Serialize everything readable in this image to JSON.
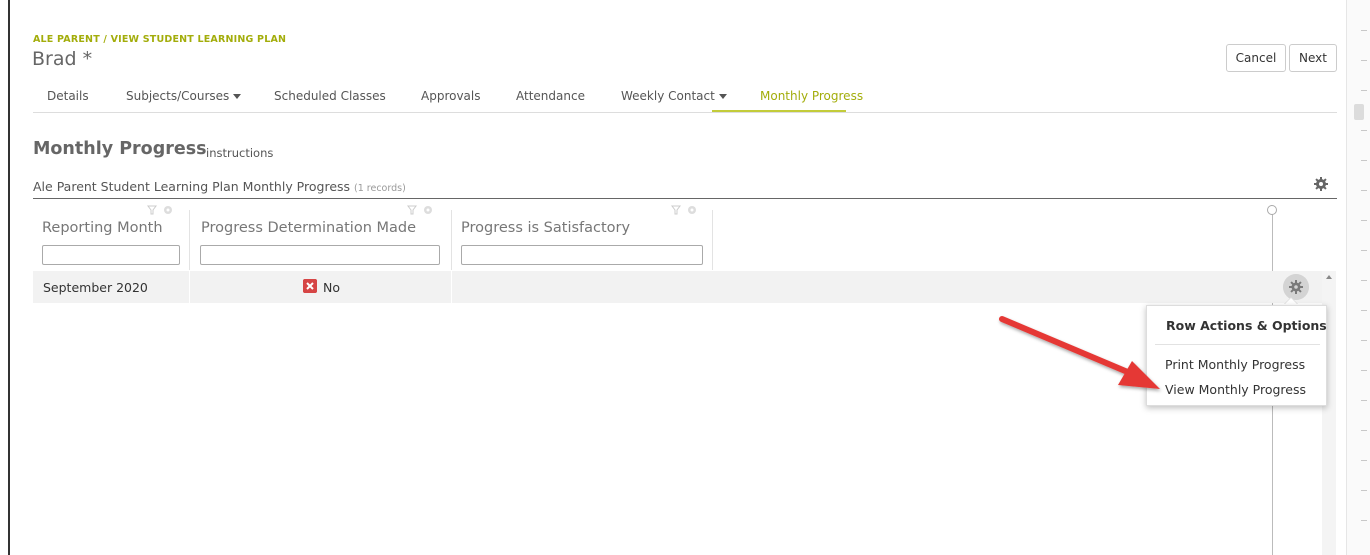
{
  "header": {
    "breadcrumb": "ALE PARENT / VIEW STUDENT LEARNING PLAN",
    "title": "Brad *",
    "cancel_label": "Cancel",
    "next_label": "Next"
  },
  "tabs": [
    {
      "label": "Details",
      "has_dropdown": false,
      "active": false
    },
    {
      "label": "Subjects/Courses",
      "has_dropdown": true,
      "active": false
    },
    {
      "label": "Scheduled Classes",
      "has_dropdown": false,
      "active": false
    },
    {
      "label": "Approvals",
      "has_dropdown": false,
      "active": false
    },
    {
      "label": "Attendance",
      "has_dropdown": false,
      "active": false
    },
    {
      "label": "Weekly Contact",
      "has_dropdown": true,
      "active": false
    },
    {
      "label": "Monthly Progress",
      "has_dropdown": false,
      "active": true
    }
  ],
  "section": {
    "title": "Monthly Progress",
    "instructions_link": "instructions"
  },
  "grid": {
    "title": "Ale Parent Student Learning Plan Monthly Progress",
    "count_text": "(1 records)",
    "columns": [
      "Reporting Month",
      "Progress Determination Made",
      "Progress is Satisfactory"
    ],
    "rows": [
      {
        "reporting_month": "September 2020",
        "progress_determination": "No",
        "progress_satisfactory": ""
      }
    ]
  },
  "row_actions": {
    "title": "Row Actions & Options",
    "items": [
      "Print Monthly Progress",
      "View Monthly Progress"
    ]
  },
  "colors": {
    "accent": "#a3ad0b",
    "badge_no": "#d64545",
    "arrow": "#e53935"
  },
  "icons": [
    "gear-icon",
    "filter-icon",
    "close-x-icon",
    "chevron-down-icon"
  ]
}
